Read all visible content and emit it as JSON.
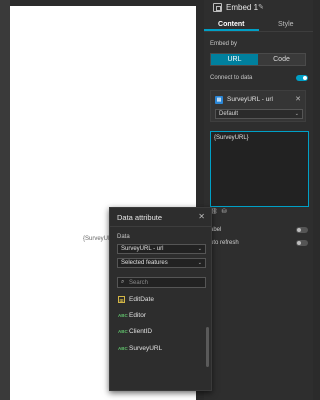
{
  "canvas": {
    "placeholder_text": "{SurveyURL"
  },
  "panel": {
    "widget_title": "Embed 1",
    "tabs": [
      {
        "label": "Content",
        "active": true
      },
      {
        "label": "Style",
        "active": false
      }
    ],
    "embed_by": {
      "label": "Embed by",
      "options": [
        {
          "label": "URL",
          "active": true
        },
        {
          "label": "Code",
          "active": false
        }
      ]
    },
    "connect_to_data": {
      "label": "Connect to data",
      "enabled": true
    },
    "data_source": {
      "name": "SurveyURL - url",
      "view": "Default"
    },
    "url_editor": {
      "value": "{SurveyURL}"
    },
    "options": [
      {
        "label": "abel",
        "enabled": false
      },
      {
        "label": "uto refresh",
        "enabled": false
      }
    ]
  },
  "popup": {
    "title": "Data attribute",
    "data_label": "Data",
    "data_source_value": "SurveyURL - url",
    "selection_value": "Selected features",
    "search_placeholder": "Search",
    "fields": [
      {
        "name": "EditDate",
        "type": "date"
      },
      {
        "name": "Editor",
        "type": "string"
      },
      {
        "name": "ClientID",
        "type": "string"
      },
      {
        "name": "SurveyURL",
        "type": "string"
      }
    ],
    "string_type_badge": "ABC"
  },
  "colors": {
    "accent": "#00a0c6",
    "panel_bg": "#2e2e2e",
    "string_icon": "#5fbf6b",
    "date_icon": "#d3b646"
  }
}
